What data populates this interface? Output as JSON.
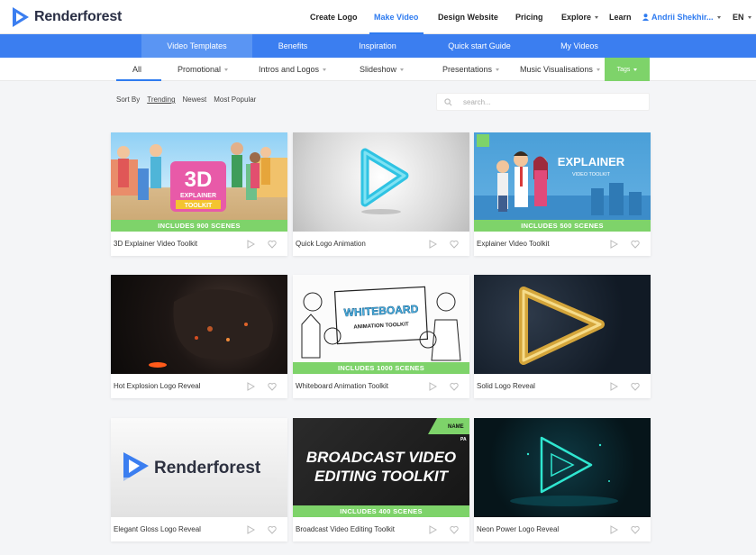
{
  "brand": {
    "name": "Renderforest",
    "accent": "#3b7ef0",
    "green": "#7ed36a"
  },
  "topnav": {
    "create_logo": "Create Logo",
    "make_video": "Make Video",
    "design_website": "Design Website",
    "pricing": "Pricing",
    "explore": "Explore",
    "learn": "Learn",
    "user": "Andrii Shekhir...",
    "lang": "EN"
  },
  "subnav": [
    "Video Templates",
    "Benefits",
    "Inspiration",
    "Quick start Guide",
    "My Videos"
  ],
  "categories": [
    "All",
    "Promotional",
    "Intros and Logos",
    "Slideshow",
    "Presentations",
    "Music Visualisations"
  ],
  "tags_label": "Tags",
  "sort": {
    "label": "Sort By",
    "options": [
      "Trending",
      "Newest",
      "Most Popular"
    ]
  },
  "search": {
    "placeholder": "search..."
  },
  "cards": [
    {
      "title": "3D Explainer Video Toolkit",
      "banner": "INCLUDES 900 SCENES"
    },
    {
      "title": "Quick Logo Animation",
      "banner": ""
    },
    {
      "title": "Explainer Video Toolkit",
      "banner": "INCLUDES 500 SCENES"
    },
    {
      "title": "Hot Explosion Logo Reveal",
      "banner": ""
    },
    {
      "title": "Whiteboard Animation Toolkit",
      "banner": "INCLUDES 1000 SCENES"
    },
    {
      "title": "Solid Logo Reveal",
      "banner": ""
    },
    {
      "title": "Elegant Gloss Logo Reveal",
      "banner": ""
    },
    {
      "title": "Broadcast Video Editing Toolkit",
      "banner": "INCLUDES 400 SCENES"
    },
    {
      "title": "Neon Power Logo Reveal",
      "banner": ""
    }
  ],
  "thumb_text": {
    "t1_big": "3D",
    "t1_small": "EXPLAINER",
    "t1_small2": "TOOLKIT",
    "t3_big": "EXPLAINER",
    "t3_small": "VIDEO TOOLKIT",
    "t5_big": "WHITEBOARD",
    "t5_small": "ANIMATION TOOLKIT",
    "t7_logo": "Renderforest",
    "t8_line1": "BROADCAST VIDEO",
    "t8_line2": "EDITING TOOLKIT",
    "t8_tag": "NAME",
    "t8_tag2": "PA"
  }
}
